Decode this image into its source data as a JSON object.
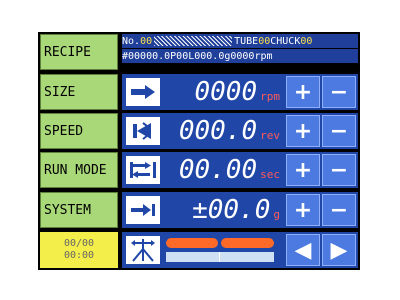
{
  "menu": [
    {
      "label": "RECIPE"
    },
    {
      "label": "SIZE"
    },
    {
      "label": "SPEED"
    },
    {
      "label": "RUN MODE"
    },
    {
      "label": "SYSTEM"
    }
  ],
  "clock": {
    "line1": "00/00",
    "line2": "00:00"
  },
  "header": {
    "no_label": "No.",
    "no_value": "00",
    "tube_label": "TUBE ",
    "tube_value": "00",
    "chuck_label": "CHUCK",
    "chuck_value": "00",
    "line2": "#00000.0P00L000.0g0000rpm"
  },
  "rows": [
    {
      "icon": "arrow-right-icon",
      "value": "0000",
      "unit": "rpm"
    },
    {
      "icon": "rotate-revolution-icon",
      "value": "000.0",
      "unit": "rev"
    },
    {
      "icon": "timer-seconds-icon",
      "value": "00.00",
      "unit": "sec"
    },
    {
      "icon": "weight-arrow-icon",
      "value": "±00.0",
      "unit": "g"
    }
  ],
  "buttons": {
    "plus": "+",
    "minus": "−",
    "left": "◀",
    "right": "▶"
  },
  "colors": {
    "menu": "#a8d878",
    "clock": "#f4ee4a",
    "row": "#2047a8",
    "button": "#4d7ae0",
    "unit": "#ff5a5a",
    "progress": "#ff6a28"
  }
}
